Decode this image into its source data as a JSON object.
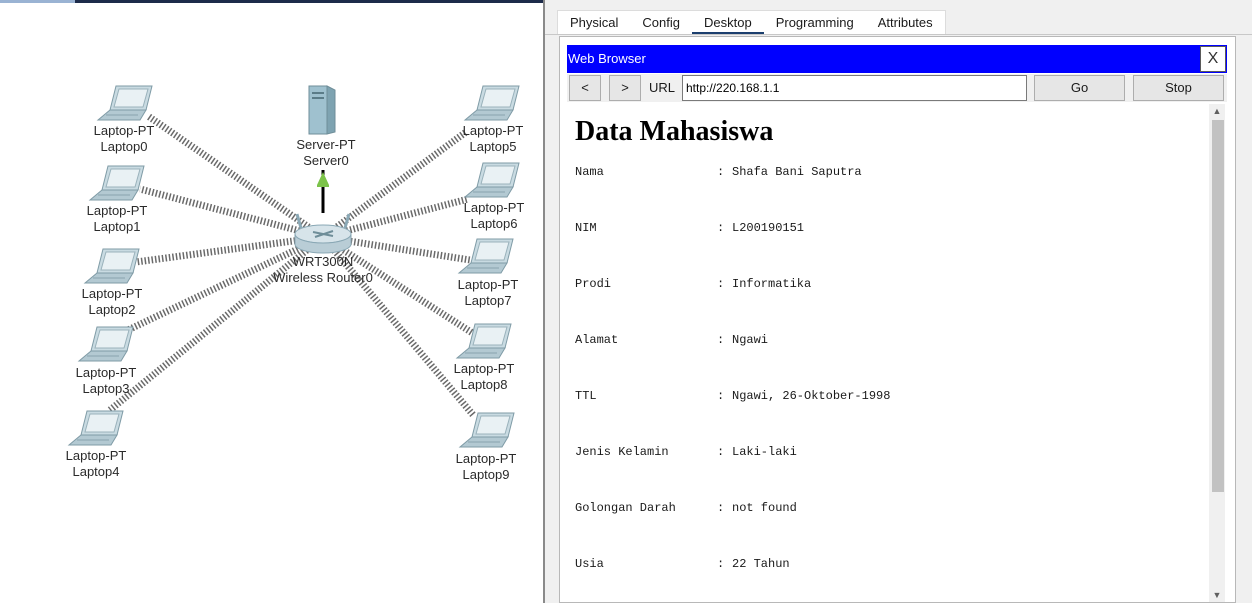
{
  "topology": {
    "server": {
      "type": "Server-PT",
      "name": "Server0"
    },
    "router": {
      "type": "WRT300N",
      "name": "Wireless Router0"
    },
    "laptops": [
      {
        "type": "Laptop-PT",
        "name": "Laptop0"
      },
      {
        "type": "Laptop-PT",
        "name": "Laptop1"
      },
      {
        "type": "Laptop-PT",
        "name": "Laptop2"
      },
      {
        "type": "Laptop-PT",
        "name": "Laptop3"
      },
      {
        "type": "Laptop-PT",
        "name": "Laptop4"
      },
      {
        "type": "Laptop-PT",
        "name": "Laptop5"
      },
      {
        "type": "Laptop-PT",
        "name": "Laptop6"
      },
      {
        "type": "Laptop-PT",
        "name": "Laptop7"
      },
      {
        "type": "Laptop-PT",
        "name": "Laptop8"
      },
      {
        "type": "Laptop-PT",
        "name": "Laptop9"
      }
    ],
    "link_status_color": "#7cc34a"
  },
  "tabs": [
    {
      "label": "Physical"
    },
    {
      "label": "Config"
    },
    {
      "label": "Desktop",
      "active": true
    },
    {
      "label": "Programming"
    },
    {
      "label": "Attributes"
    }
  ],
  "browser": {
    "title": "Web Browser",
    "title_bar_color": "#0000ff",
    "close_label": "X",
    "back_label": "<",
    "forward_label": ">",
    "url_label": "URL",
    "url_value": "http://220.168.1.1",
    "go_label": "Go",
    "stop_label": "Stop"
  },
  "page": {
    "heading": "Data Mahasiswa",
    "rows": [
      {
        "key": "Nama",
        "value": "Shafa Bani Saputra"
      },
      {
        "key": "NIM",
        "value": "L200190151"
      },
      {
        "key": "Prodi",
        "value": "Informatika"
      },
      {
        "key": "Alamat",
        "value": "Ngawi"
      },
      {
        "key": "TTL",
        "value": "Ngawi, 26-Oktober-1998"
      },
      {
        "key": "Jenis Kelamin",
        "value": "Laki-laki"
      },
      {
        "key": "Golongan Darah",
        "value": "not found"
      },
      {
        "key": "Usia",
        "value": "22 Tahun"
      }
    ],
    "separator": ":"
  }
}
